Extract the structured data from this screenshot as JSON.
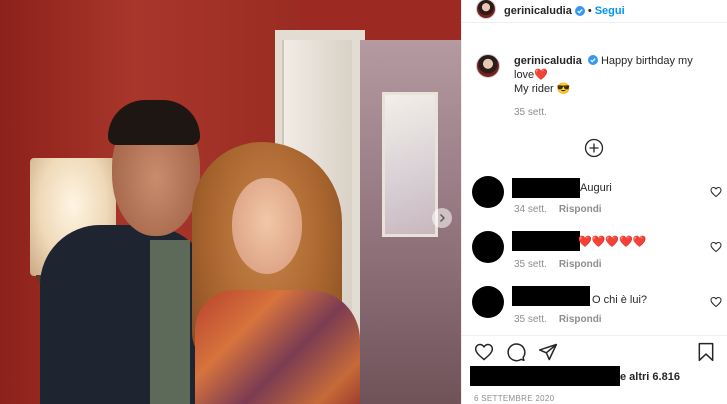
{
  "post": {
    "username": "gerinicaludia",
    "follow_label": "Segui",
    "separator": "•"
  },
  "caption": {
    "username": "gerinicaludia",
    "text_line1": "Happy birthday my",
    "text_line2": "love❤️",
    "text_line3": "My rider 😎",
    "time": "35 sett."
  },
  "comments": [
    {
      "text": "Auguri",
      "time": "34 sett.",
      "reply_label": "Rispondi"
    },
    {
      "text": "❤️❤️❤️❤️❤️",
      "time": "35 sett.",
      "reply_label": "Rispondi"
    },
    {
      "text": "O chi è lui?",
      "time": "35 sett.",
      "reply_label": "Rispondi"
    }
  ],
  "likes": {
    "text": "e altri 6.816"
  },
  "date": "6 SETTEMBRE 2020",
  "icons": {
    "load_more": "plus-circle-icon",
    "like": "heart-icon",
    "comment": "comment-icon",
    "share": "paper-plane-icon",
    "save": "bookmark-icon",
    "verified": "verified-badge-icon",
    "next": "chevron-right-icon"
  },
  "colors": {
    "accent": "#0095f6",
    "verified": "#3897f0",
    "muted": "#8e8e8e",
    "text": "#262626"
  }
}
